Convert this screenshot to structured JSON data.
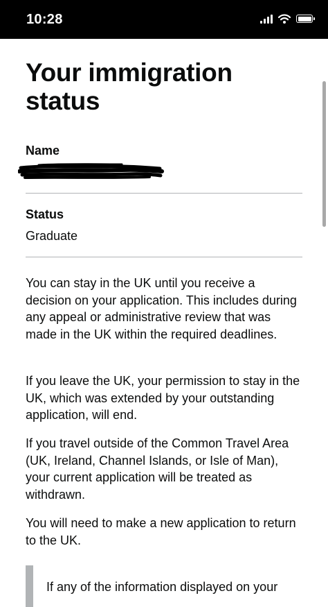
{
  "status_bar": {
    "time": "10:28",
    "icons": [
      "cellular-signal-icon",
      "wifi-icon",
      "battery-icon"
    ]
  },
  "page": {
    "title": "Your immigration status"
  },
  "summary": {
    "name_label": "Name",
    "name_value_redacted": true,
    "status_label": "Status",
    "status_value": "Graduate"
  },
  "body": {
    "paragraphs": [
      "You can stay in the UK until you receive a decision on your application. This includes during any appeal or administrative review that was made in the UK within the required deadlines.",
      "If you leave the UK, your permission to stay in the UK, which was extended by your outstanding application, will end.",
      "If you travel outside of the Common Travel Area (UK, Ireland, Channel Islands, or Isle of Man), your current application will be treated as withdrawn.",
      "You will need to make a new application to return to the UK."
    ],
    "inset_text": "If any of the information displayed on your"
  },
  "colors": {
    "status_bar_bg": "#000000",
    "text": "#0b0c0c",
    "divider": "#b1b4b6",
    "inset_border": "#b1b4b6"
  }
}
